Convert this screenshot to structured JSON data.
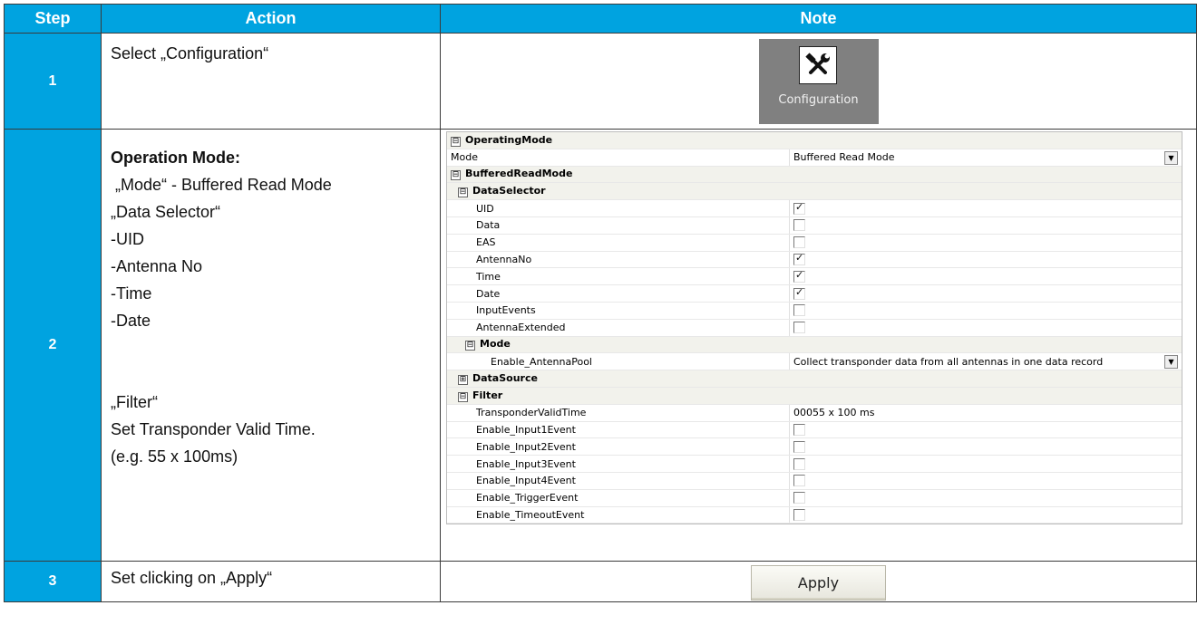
{
  "headers": {
    "step": "Step",
    "action": "Action",
    "note": "Note"
  },
  "rows": [
    {
      "step": "1",
      "action": [
        "Select „Configuration“"
      ],
      "button_label": "Configuration",
      "icon": "hammer-wrench-icon"
    },
    {
      "step": "2",
      "action": [
        "Operation Mode:",
        " „Mode“ - Buffered Read Mode",
        "„Data Selector“",
        "-UID",
        "-Antenna No",
        "-Time",
        "-Date",
        "",
        "„Filter“",
        "Set Transponder Valid Time.",
        "(e.g. 55 x 100ms)"
      ]
    },
    {
      "step": "3",
      "action": [
        "Set clicking on „Apply“"
      ],
      "button_label": "Apply"
    }
  ],
  "property_grid": [
    {
      "kind": "cat",
      "level": 0,
      "toggle": "⊟",
      "name": "OperatingMode"
    },
    {
      "kind": "prop",
      "level": 0,
      "name": "Mode",
      "value": "Buffered Read Mode",
      "dropdown": true
    },
    {
      "kind": "cat",
      "level": 1,
      "toggle": "⊟",
      "name": "BufferedReadMode"
    },
    {
      "kind": "cat",
      "level": 2,
      "toggle": "⊟",
      "name": "DataSelector"
    },
    {
      "kind": "prop",
      "level": 3,
      "name": "UID",
      "checked": true
    },
    {
      "kind": "prop",
      "level": 3,
      "name": "Data",
      "checked": false
    },
    {
      "kind": "prop",
      "level": 3,
      "name": "EAS",
      "checked": false
    },
    {
      "kind": "prop",
      "level": 3,
      "name": "AntennaNo",
      "checked": true
    },
    {
      "kind": "prop",
      "level": 3,
      "name": "Time",
      "checked": true
    },
    {
      "kind": "prop",
      "level": 3,
      "name": "Date",
      "checked": true
    },
    {
      "kind": "prop",
      "level": 3,
      "name": "InputEvents",
      "checked": false
    },
    {
      "kind": "prop",
      "level": 3,
      "name": "AntennaExtended",
      "checked": false
    },
    {
      "kind": "cat",
      "level": 3,
      "toggle": "⊟",
      "name": "Mode"
    },
    {
      "kind": "prop",
      "level": 4,
      "name": "Enable_AntennaPool",
      "value": "Collect transponder data from all antennas in one data record",
      "dropdown": true
    },
    {
      "kind": "cat",
      "level": 2,
      "toggle": "⊞",
      "name": "DataSource"
    },
    {
      "kind": "cat",
      "level": 2,
      "toggle": "⊟",
      "name": "Filter"
    },
    {
      "kind": "prop",
      "level": 3,
      "name": "TransponderValidTime",
      "value": "00055 x 100 ms"
    },
    {
      "kind": "prop",
      "level": 3,
      "name": "Enable_Input1Event",
      "checked": false
    },
    {
      "kind": "prop",
      "level": 3,
      "name": "Enable_Input2Event",
      "checked": false
    },
    {
      "kind": "prop",
      "level": 3,
      "name": "Enable_Input3Event",
      "checked": false
    },
    {
      "kind": "prop",
      "level": 3,
      "name": "Enable_Input4Event",
      "checked": false
    },
    {
      "kind": "prop",
      "level": 3,
      "name": "Enable_TriggerEvent",
      "checked": false
    },
    {
      "kind": "prop",
      "level": 3,
      "name": "Enable_TimeoutEvent",
      "checked": false
    }
  ]
}
